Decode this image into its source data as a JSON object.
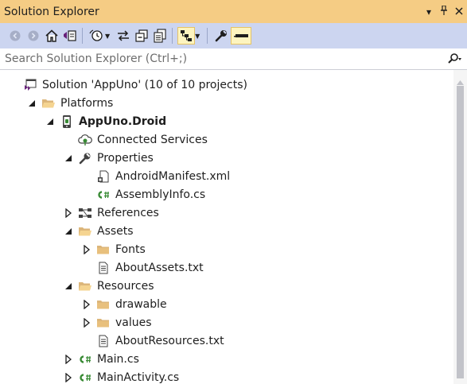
{
  "window": {
    "title": "Solution Explorer"
  },
  "search": {
    "placeholder": "Search Solution Explorer (Ctrl+;)"
  },
  "toolbar": {
    "buttons": [
      "back-icon",
      "forward-icon",
      "home-icon",
      "switch-views-icon",
      "pending-changes-filter-icon",
      "sync-active-document-icon",
      "collapse-all-icon",
      "show-all-files-icon",
      "show-hierarchy-icon",
      "properties-icon",
      "preview-selected-items-icon"
    ]
  },
  "tree": [
    {
      "label": "Solution 'AppUno' (10 of 10 projects)",
      "depth": 0,
      "expander": "none",
      "icon": "solution-icon",
      "bold": false
    },
    {
      "label": "Platforms",
      "depth": 1,
      "expander": "expanded",
      "icon": "folder-open-icon",
      "bold": false
    },
    {
      "label": "AppUno.Droid",
      "depth": 2,
      "expander": "expanded",
      "icon": "android-project-icon",
      "bold": true
    },
    {
      "label": "Connected Services",
      "depth": 3,
      "expander": "none",
      "icon": "connected-services-icon",
      "bold": false
    },
    {
      "label": "Properties",
      "depth": 3,
      "expander": "expanded",
      "icon": "wrench-icon",
      "bold": false
    },
    {
      "label": "AndroidManifest.xml",
      "depth": 4,
      "expander": "none",
      "icon": "manifest-icon",
      "bold": false
    },
    {
      "label": "AssemblyInfo.cs",
      "depth": 4,
      "expander": "none",
      "icon": "csharp-file-icon",
      "bold": false
    },
    {
      "label": "References",
      "depth": 3,
      "expander": "collapsed",
      "icon": "references-icon",
      "bold": false
    },
    {
      "label": "Assets",
      "depth": 3,
      "expander": "expanded",
      "icon": "folder-open-icon",
      "bold": false
    },
    {
      "label": "Fonts",
      "depth": 4,
      "expander": "collapsed",
      "icon": "folder-icon",
      "bold": false
    },
    {
      "label": "AboutAssets.txt",
      "depth": 4,
      "expander": "none",
      "icon": "text-file-icon",
      "bold": false
    },
    {
      "label": "Resources",
      "depth": 3,
      "expander": "expanded",
      "icon": "folder-open-icon",
      "bold": false
    },
    {
      "label": "drawable",
      "depth": 4,
      "expander": "collapsed",
      "icon": "folder-icon",
      "bold": false
    },
    {
      "label": "values",
      "depth": 4,
      "expander": "collapsed",
      "icon": "folder-icon",
      "bold": false
    },
    {
      "label": "AboutResources.txt",
      "depth": 4,
      "expander": "none",
      "icon": "text-file-icon",
      "bold": false
    },
    {
      "label": "Main.cs",
      "depth": 3,
      "expander": "collapsed",
      "icon": "csharp-file-icon",
      "bold": false
    },
    {
      "label": "MainActivity.cs",
      "depth": 3,
      "expander": "collapsed",
      "icon": "csharp-file-icon",
      "bold": false
    }
  ]
}
